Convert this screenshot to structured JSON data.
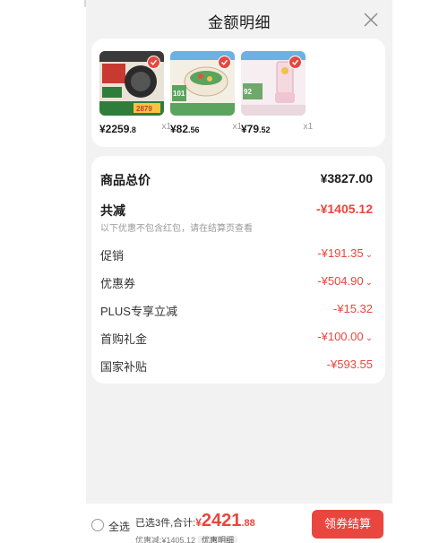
{
  "header": {
    "title": "金额明细",
    "close_icon": "close-icon"
  },
  "products": [
    {
      "name": "product-1",
      "price_int": "¥2259",
      "price_dec": ".8",
      "qty": "x1",
      "thumb_text": "2879",
      "colors": [
        "#2b2b2b",
        "#c83a2f",
        "#2f7d3a"
      ]
    },
    {
      "name": "product-2",
      "price_int": "¥82",
      "price_dec": ".56",
      "qty": "x1",
      "thumb_text": "101",
      "colors": [
        "#f1e7d6",
        "#5aa45d",
        "#e9d5a8"
      ]
    },
    {
      "name": "product-3",
      "price_int": "¥79",
      "price_dec": ".52",
      "qty": "x1",
      "thumb_text": "92",
      "colors": [
        "#f4d9e1",
        "#6ea86a",
        "#f6eef1"
      ]
    }
  ],
  "summary": {
    "subtotal_label": "商品总价",
    "subtotal_value": "¥3827.00",
    "reduction_label": "共减",
    "reduction_value": "-¥1405.12",
    "note": "以下优惠不包含红包，请在结算页查看",
    "items": [
      {
        "label": "促销",
        "value": "-¥191.35",
        "chevron": "⌄"
      },
      {
        "label": "优惠券",
        "value": "-¥504.90",
        "chevron": "⌄"
      },
      {
        "label": "PLUS专享立减",
        "value": "-¥15.32",
        "chevron": ""
      },
      {
        "label": "首购礼金",
        "value": "-¥100.00",
        "chevron": "⌄"
      },
      {
        "label": "国家补贴",
        "value": "-¥593.55",
        "chevron": ""
      }
    ]
  },
  "footer": {
    "select_all": "全选",
    "selected_text": "已选3件,合计:",
    "total_symbol": "¥",
    "total_int": "2421",
    "total_dec": ".88",
    "discount_text": "优惠减:¥1405.12",
    "discount_tag": "优惠明细",
    "checkout_label": "领券结算"
  },
  "colors": {
    "accent": "#e8463e",
    "background": "#f2f2f2",
    "card": "#ffffff"
  }
}
